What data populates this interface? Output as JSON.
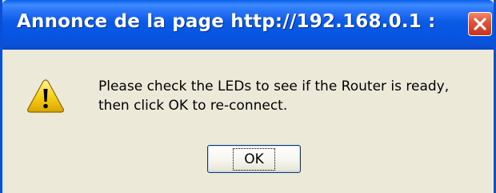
{
  "dialog": {
    "title": "Annonce de la page http://192.168.0.1 :",
    "message_lines": [
      "Please check the LEDs to see if the Router is ready,",
      "then click OK to re-connect."
    ],
    "ok_label": "OK",
    "icon": "warning-icon",
    "close_icon": "close-icon"
  },
  "colors": {
    "titlebar": "#0a5ae5",
    "body": "#ece9d8",
    "close_button": "#e0543a",
    "warning_yellow": "#f8d21a"
  }
}
